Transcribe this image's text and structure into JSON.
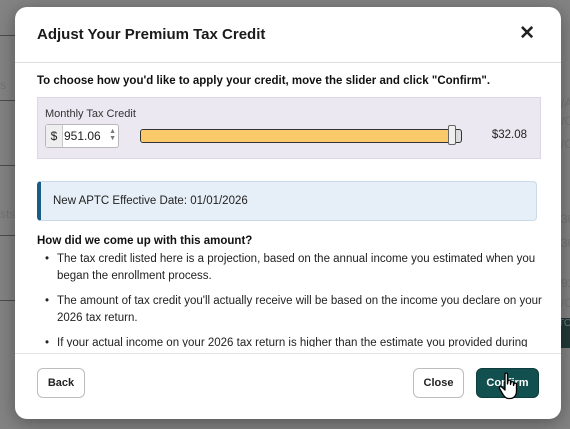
{
  "background": {
    "fragments": [
      "s",
      "sts",
      "/A",
      "/C",
      "/C",
      "30",
      "30",
      "91",
      "/C",
      "TO"
    ]
  },
  "modal": {
    "title": "Adjust Your Premium Tax Credit",
    "close_icon": "close-icon",
    "instruction": "To choose how you'd like to apply your credit, move the slider and click \"Confirm\".",
    "slider": {
      "label": "Monthly Tax Credit",
      "currency_symbol": "$",
      "amount_value": "951.06",
      "remaining_value": "$32.08",
      "fill_fraction": 0.972,
      "fill_color": "#f9c96a"
    },
    "info_banner": {
      "text": "New APTC Effective Date: 01/01/2026",
      "accent_color": "#1a5d84"
    },
    "explanation": {
      "heading": "How did we come up with this amount?",
      "bullets": [
        "The tax credit listed here is a projection, based on the annual income you estimated when you began the enrollment process.",
        "The amount of tax credit you'll actually receive will be based on the income you declare on your 2026 tax return.",
        "If your actual income on your 2026 tax return is higher than the estimate you provided during"
      ]
    },
    "footer": {
      "back_label": "Back",
      "close_label": "Close",
      "confirm_label": "Confirm",
      "confirm_color": "#12504f"
    }
  }
}
